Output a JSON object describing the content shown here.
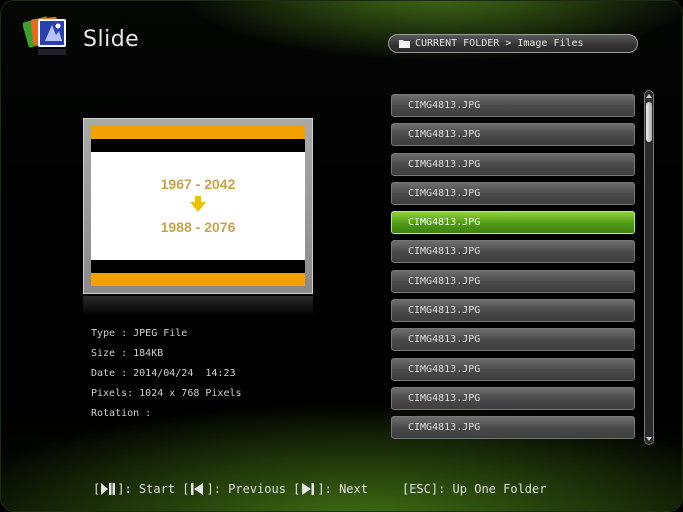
{
  "header": {
    "title": "Slide",
    "folder_path": "CURRENT FOLDER > Image Files"
  },
  "preview": {
    "image_text_top": "1967 - 2042",
    "image_text_bottom": "1988 - 2076"
  },
  "info": {
    "type": "Type : JPEG File",
    "size": "Size : 184KB",
    "date": "Date : 2014/04/24  14:23",
    "pixels": "Pixels: 1024 x 768 Pixels",
    "rotation": "Rotation :"
  },
  "file_list": {
    "items": [
      {
        "label": "CIMG4813.JPG",
        "selected": false
      },
      {
        "label": "CIMG4813.JPG",
        "selected": false
      },
      {
        "label": "CIMG4813.JPG",
        "selected": false
      },
      {
        "label": "CIMG4813.JPG",
        "selected": false
      },
      {
        "label": "CIMG4813.JPG",
        "selected": true
      },
      {
        "label": "CIMG4813.JPG",
        "selected": false
      },
      {
        "label": "CIMG4813.JPG",
        "selected": false
      },
      {
        "label": "CIMG4813.JPG",
        "selected": false
      },
      {
        "label": "CIMG4813.JPG",
        "selected": false
      },
      {
        "label": "CIMG4813.JPG",
        "selected": false
      },
      {
        "label": "CIMG4813.JPG",
        "selected": false
      },
      {
        "label": "CIMG4813.JPG",
        "selected": false
      }
    ],
    "scroll_position": 0.1
  },
  "footer": {
    "start_label": "]: Start [",
    "previous_label": "]: Previous [",
    "next_label": "]: Next",
    "esc_label": "[ESC]: Up One Folder"
  },
  "colors": {
    "accent_green": "#6fbf25",
    "highlight_orange": "#f4a000"
  },
  "icons": {
    "app": "photo-stack-icon",
    "folder": "folder-icon",
    "play_pause": "play-pause-key-icon",
    "previous": "skip-previous-key-icon",
    "next": "skip-next-key-icon"
  }
}
